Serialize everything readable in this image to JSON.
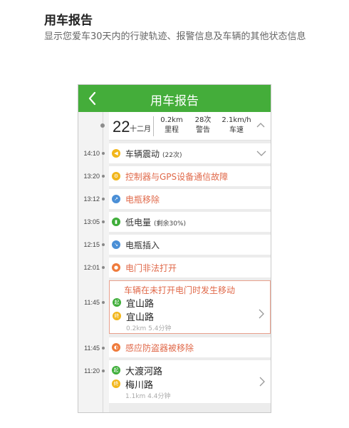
{
  "intro": {
    "title": "用车报告",
    "description": "显示您爱车30天内的行驶轨迹、报警信息及车辆的其他状态信息"
  },
  "appbar": {
    "title": "用车报告",
    "back_icon": "chevron-left-icon"
  },
  "summary": {
    "day": "22",
    "month": "十二月",
    "stats": [
      {
        "value": "0.2km",
        "label": "里程"
      },
      {
        "value": "28次",
        "label": "警告"
      },
      {
        "value": "2.1km/h",
        "label": "车速"
      }
    ]
  },
  "colors": {
    "brand": "#44ad3a",
    "alert": "#e0694a",
    "yellow": "#f2b61a",
    "blue": "#4a8fd6",
    "green": "#3fae3a",
    "orange": "#ef7b3c"
  },
  "events": [
    {
      "time": "14:10",
      "label": "车辆震动",
      "sub": "(22次)",
      "icon": "vibration-icon",
      "alert": false
    },
    {
      "time": "13:20",
      "label": "控制器与GPS设备通信故障",
      "sub": "",
      "icon": "warning-icon",
      "alert": true
    },
    {
      "time": "13:12",
      "label": "电瓶移除",
      "sub": "",
      "icon": "battery-icon",
      "alert": true
    },
    {
      "time": "13:05",
      "label": "低电量",
      "sub": "(剩余30%)",
      "icon": "battery-low-icon",
      "alert": false
    },
    {
      "time": "12:15",
      "label": "电瓶插入",
      "sub": "",
      "icon": "plug-icon",
      "alert": false
    },
    {
      "time": "12:01",
      "label": "电门非法打开",
      "sub": "",
      "icon": "key-icon",
      "alert": true
    },
    {
      "time": "11:45",
      "label": "感应防盗器被移除",
      "sub": "",
      "icon": "alarm-icon",
      "alert": true
    }
  ],
  "trips": [
    {
      "time": "11:45",
      "title": "车辆在未打开电门时发生移动",
      "start": "宜山路",
      "end": "宜山路",
      "meta": "0.2km  5.4分钟",
      "start_badge": "起",
      "end_badge": "终"
    },
    {
      "time": "11:20",
      "title": "",
      "start": "大渡河路",
      "end": "梅川路",
      "meta": "1.1km  4.4分钟",
      "start_badge": "起",
      "end_badge": "终"
    }
  ]
}
